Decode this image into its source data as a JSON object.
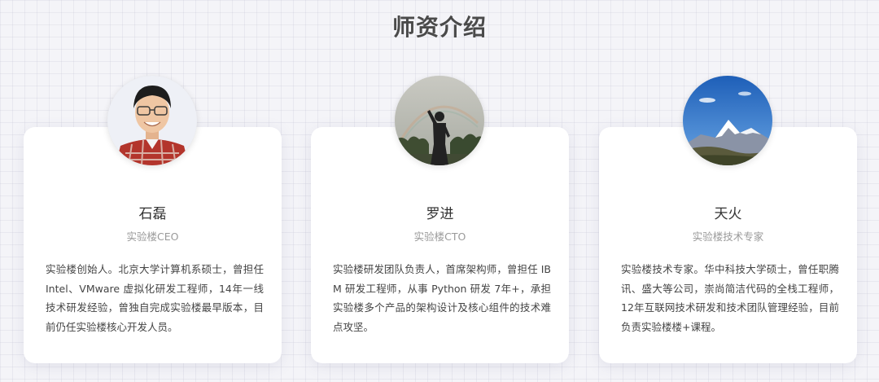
{
  "section": {
    "title": "师资介绍"
  },
  "teachers": [
    {
      "name": "石磊",
      "role": "实验楼CEO",
      "description": "实验楼创始人。北京大学计算机系硕士，曾担任 Intel、VMware 虚拟化研发工程师，14年一线技术研发经验，曾独自完成实验楼最早版本，目前仍任实验楼核心开发人员。",
      "avatar_icon": "person-portrait-photo"
    },
    {
      "name": "罗进",
      "role": "实验楼CTO",
      "description": "实验楼研发团队负责人，首席架构师，曾担任 IBM 研发工程师，从事 Python 研发 7年+，承担实验楼多个产品的架构设计及核心组件的技术难点攻坚。",
      "avatar_icon": "silhouette-sky-photo"
    },
    {
      "name": "天火",
      "role": "实验楼技术专家",
      "description": "实验楼技术专家。华中科技大学硕士，曾任职腾讯、盛大等公司，崇尚简洁代码的全栈工程师，12年互联网技术研发和技术团队管理经验，目前负责实验楼楼+课程。",
      "avatar_icon": "snow-mountain-photo"
    }
  ],
  "colors": {
    "title": "#4a4a4a",
    "name": "#333333",
    "role": "#9a9a9a",
    "description": "#444444",
    "card_background": "#ffffff",
    "page_background": "#f4f4f8"
  }
}
